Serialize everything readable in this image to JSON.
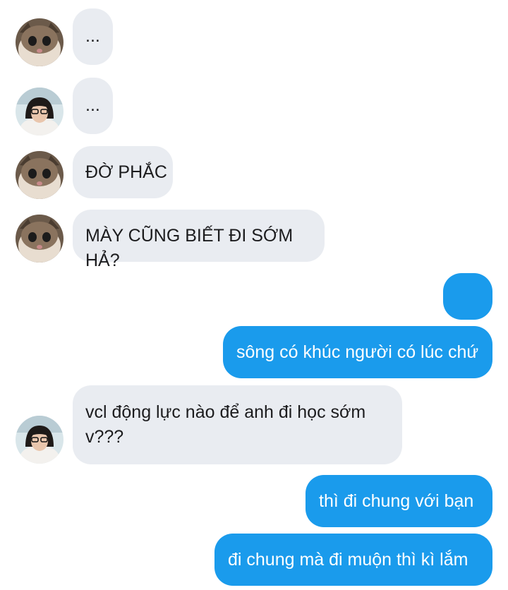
{
  "conversation": {
    "messages": [
      {
        "sender": "cat",
        "text": "..."
      },
      {
        "sender": "girl",
        "text": "..."
      },
      {
        "sender": "cat",
        "text": "ĐỜ PHẮC"
      },
      {
        "sender": "cat",
        "text": "MÀY CŨNG BIẾT ĐI SỚM HẢ?"
      },
      {
        "sender": "me",
        "text": "😀"
      },
      {
        "sender": "me",
        "text": "sông có khúc người có lúc chứ"
      },
      {
        "sender": "girl",
        "text": "vcl động lực nào để anh đi học sớm v???"
      },
      {
        "sender": "me",
        "text": "thì đi chung với bạn"
      },
      {
        "sender": "me",
        "text": "đi chung mà đi muộn thì kì lắm"
      }
    ]
  },
  "colors": {
    "outgoing_bubble": "#1a9bec",
    "incoming_bubble": "#e9ecf1"
  },
  "icons": {
    "cat_avatar": "cat-avatar-icon",
    "girl_avatar": "girl-avatar-icon"
  }
}
